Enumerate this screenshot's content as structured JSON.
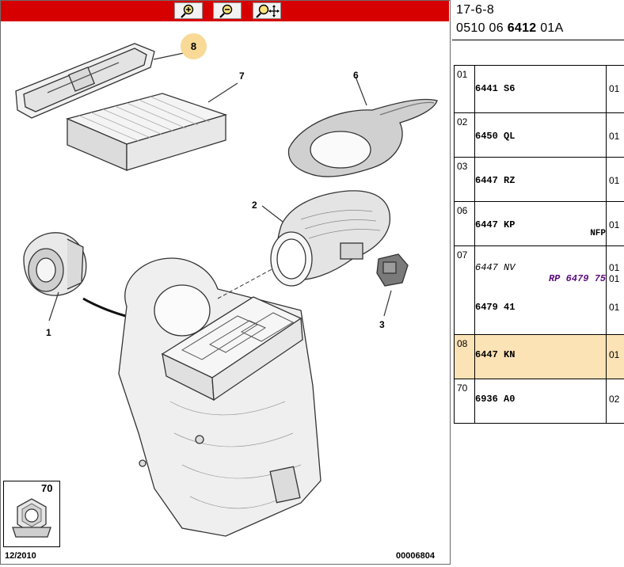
{
  "toolbar": {
    "zoom_in": "zoom-in",
    "zoom_out": "zoom-out",
    "pan": "pan"
  },
  "callouts": {
    "c8": "8",
    "c7": "7",
    "c6": "6",
    "c2": "2",
    "c1": "1",
    "c3": "3"
  },
  "fastener": {
    "ref": "70"
  },
  "footer": {
    "date": "12/2010",
    "code": "00006804"
  },
  "header": {
    "line1": "17-6-8",
    "line2_a": "0510 06 ",
    "line2_b": "6412",
    "line2_c": " 01A"
  },
  "parts": [
    {
      "idx": "01",
      "part": "6441 S6",
      "qty": "01"
    },
    {
      "idx": "02",
      "part": "6450 QL",
      "qty": "01"
    },
    {
      "idx": "03",
      "part": "6447 RZ",
      "qty": "01"
    },
    {
      "idx": "06",
      "part": "6447 KP",
      "note": "NFP",
      "qty": "01"
    },
    {
      "idx": "07",
      "part": "6447 NV",
      "substitute": "RP 6479 75",
      "alt_part": "6479 41",
      "qty": "01",
      "qty2": "01",
      "qty3": "01"
    },
    {
      "idx": "08",
      "part": "6447 KN",
      "qty": "01"
    },
    {
      "idx": "70",
      "part": "6936 A0",
      "qty": "02"
    }
  ],
  "colors": {
    "toolbar": "#d70000",
    "selected_row": "#fbe3b6",
    "callout_highlight": "#f8d995",
    "substitute_text": "#5a0d7a"
  }
}
